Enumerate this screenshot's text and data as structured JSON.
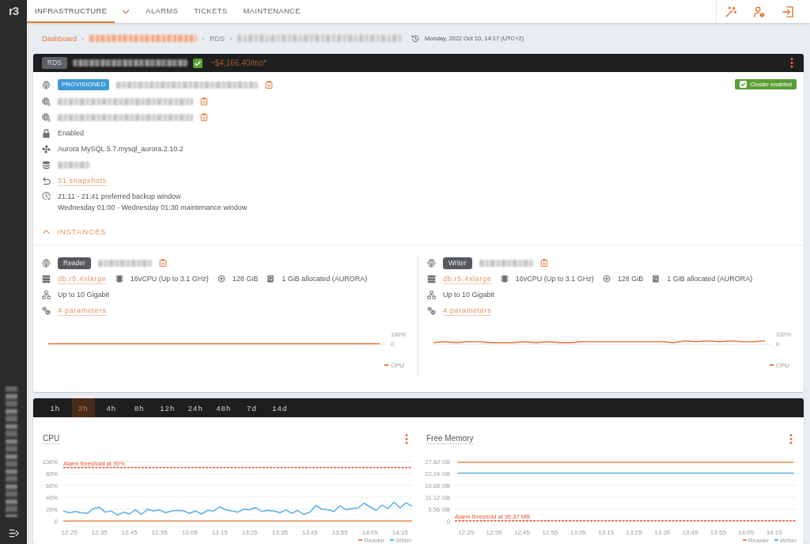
{
  "sidebar": {
    "logo": "r3",
    "redacted": true
  },
  "nav": {
    "tabs": [
      {
        "label": "INFRASTRUCTURE",
        "selected": true
      },
      {
        "label": "ALARMS",
        "selected": false
      },
      {
        "label": "TICKETS",
        "selected": false
      },
      {
        "label": "MAINTENANCE",
        "selected": false
      }
    ]
  },
  "breadcrumb": {
    "items": [
      {
        "kind": "link",
        "label": "Dashboard"
      },
      {
        "kind": "redacted-link"
      },
      {
        "kind": "text",
        "label": "RDS"
      },
      {
        "kind": "redacted"
      }
    ],
    "timestamp": "Monday, 2022 Oct 10, 14:17 (UTC+2)"
  },
  "cluster": {
    "type_badge": "RDS",
    "name_redacted": true,
    "header_checkbox": {
      "checked": true
    },
    "cost": "~$4,166.40/mo*",
    "cluster_enabled": {
      "label": "Cluster enabled",
      "checked": true
    },
    "details": [
      {
        "kind": "identifier",
        "badge": "PROVISIONED",
        "redacted": true,
        "copyable": true
      },
      {
        "kind": "endpoint",
        "redacted": true,
        "copyable": true
      },
      {
        "kind": "endpoint",
        "redacted": true,
        "copyable": true
      },
      {
        "kind": "encryption",
        "text": "Enabled"
      },
      {
        "kind": "engine",
        "text": "Aurora MySQL 5.7.mysql_aurora.2.10.2"
      },
      {
        "kind": "database",
        "redacted": true
      },
      {
        "kind": "snapshots",
        "link": "31 snapshots"
      },
      {
        "kind": "schedule",
        "lines": [
          "21:11 - 21:41 preferred backup window",
          "Wednesday 01:00 - Wednesday 01:30 maintenance window"
        ]
      }
    ],
    "instances_section": {
      "label": "INSTANCES",
      "expanded": true
    },
    "instances": [
      {
        "role": "Reader",
        "redacted": true,
        "copyable": true,
        "instance_class": "db.r5.4xlarge",
        "cpu": "16vCPU (Up to 3.1 GHz)",
        "memory": "128 GiB",
        "storage": "1 GiB allocated (AURORA)",
        "network": "Up to 10 Gigabit",
        "parameters": "4 parameters",
        "chart_data": {
          "type": "line",
          "ylim": [
            0,
            100
          ],
          "yticks": [
            0,
            {
              "value": 100,
              "label": "100%"
            }
          ],
          "legend": "bottom-right",
          "series": [
            {
              "name": "CPU",
              "color": "#e8793e",
              "values": [
                0,
                0,
                0,
                0,
                0,
                0,
                0,
                0,
                0,
                0,
                0,
                0,
                0,
                0,
                0,
                0,
                0,
                0,
                0,
                0,
                0,
                0,
                0,
                0,
                0,
                0,
                0,
                0,
                0,
                0
              ]
            }
          ]
        }
      },
      {
        "role": "Writer",
        "redacted": true,
        "copyable": true,
        "instance_class": "db.r5.4xlarge",
        "cpu": "16vCPU (Up to 3.1 GHz)",
        "memory": "128 GiB",
        "storage": "1 GiB allocated (AURORA)",
        "network": "Up to 10 Gigabit",
        "parameters": "4 parameters",
        "chart_data": {
          "type": "line",
          "ylim": [
            0,
            100
          ],
          "yticks": [
            0,
            {
              "value": 100,
              "label": "100%"
            }
          ],
          "legend": "bottom-right",
          "series": [
            {
              "name": "CPU",
              "color": "#e8793e",
              "values": [
                10,
                20,
                10,
                20,
                20,
                10,
                10,
                10,
                20,
                10,
                20,
                10,
                10,
                20,
                20,
                20,
                20,
                20,
                20,
                20,
                20,
                10,
                30,
                20,
                30,
                20,
                30,
                20,
                20,
                30
              ]
            }
          ]
        }
      }
    ]
  },
  "metrics": {
    "ranges": [
      {
        "label": "1h",
        "selected": false
      },
      {
        "label": "2h",
        "selected": true
      },
      {
        "label": "4h",
        "selected": false
      },
      {
        "label": "8h",
        "selected": false
      },
      {
        "label": "12h",
        "selected": false
      },
      {
        "label": "24h",
        "selected": false
      },
      {
        "label": "48h",
        "selected": false
      },
      {
        "label": "7d",
        "selected": false
      },
      {
        "label": "14d",
        "selected": false
      }
    ],
    "charts": [
      {
        "chart_data": {
          "type": "line",
          "title": "CPU",
          "grid": true,
          "legend": "bottom-right",
          "x": [
            743,
            745,
            747,
            749,
            751,
            753,
            755,
            757,
            759,
            761,
            763,
            765,
            767,
            769,
            771,
            773,
            775,
            777,
            779,
            781,
            783,
            785,
            787,
            789,
            791,
            793,
            795,
            797,
            799,
            801,
            803,
            805,
            807,
            809,
            811,
            813,
            815,
            817,
            819,
            821,
            823,
            825,
            827,
            829,
            831,
            833,
            835,
            837,
            839,
            841,
            843,
            845,
            847,
            849,
            851,
            853,
            855,
            857,
            859
          ],
          "xlim": [
            743,
            859
          ],
          "xticks": [
            {
              "value": 745,
              "label": "12:25"
            },
            {
              "value": 755,
              "label": "12:35"
            },
            {
              "value": 765,
              "label": "12:45"
            },
            {
              "value": 775,
              "label": "12:55"
            },
            {
              "value": 785,
              "label": "13:05"
            },
            {
              "value": 795,
              "label": "13:15"
            },
            {
              "value": 805,
              "label": "13:25"
            },
            {
              "value": 815,
              "label": "13:35"
            },
            {
              "value": 825,
              "label": "13:45"
            },
            {
              "value": 835,
              "label": "13:55"
            },
            {
              "value": 845,
              "label": "14:05"
            },
            {
              "value": 855,
              "label": "14:15"
            }
          ],
          "ylim": [
            0,
            100
          ],
          "yticks": [
            0,
            {
              "value": 20,
              "label": "20%"
            },
            {
              "value": 40,
              "label": "40%"
            },
            {
              "value": 60,
              "label": "60%"
            },
            {
              "value": 80,
              "label": "80%"
            },
            {
              "value": 100,
              "label": "100%"
            }
          ],
          "series": [
            {
              "name": "Reader",
              "color": "#ee8a50",
              "values": [
                0,
                0,
                0,
                0,
                0,
                0,
                0,
                0,
                0,
                0,
                0,
                0,
                0,
                0,
                0,
                0,
                0,
                0,
                0,
                0,
                0,
                0,
                0,
                0,
                0,
                0,
                0,
                0,
                0,
                0,
                0,
                0,
                0,
                0,
                0,
                0,
                0,
                0,
                0,
                0,
                0,
                0,
                0,
                0,
                0,
                0,
                0,
                0,
                0,
                0,
                0,
                0,
                0,
                0,
                0,
                0,
                0,
                0,
                0
              ]
            },
            {
              "name": "Writer",
              "color": "#5bb0e3",
              "values": [
                17,
                14,
                16,
                14,
                13,
                21,
                23,
                15,
                17,
                10,
                15,
                12,
                19,
                11,
                20,
                17,
                19,
                14,
                17,
                18,
                17,
                13,
                17,
                12,
                18,
                17,
                24,
                19,
                17,
                15,
                20,
                19,
                23,
                16,
                18,
                17,
                14,
                19,
                13,
                18,
                11,
                15,
                26,
                20,
                19,
                16,
                26,
                19,
                21,
                22,
                30,
                24,
                18,
                27,
                21,
                32,
                22,
                31,
                25
              ]
            }
          ],
          "ref_lines": [
            {
              "axis": "y",
              "value": 90,
              "label": "Alarm threshold at 90%",
              "color": "#e8542f"
            }
          ]
        }
      },
      {
        "chart_data": {
          "type": "line",
          "title": "Free Memory",
          "grid": true,
          "legend": "bottom-right",
          "x": [
            742,
            752,
            762,
            772,
            782,
            792,
            802,
            812,
            822,
            832,
            842,
            852,
            862
          ],
          "xlim": [
            741,
            863
          ],
          "xticks": [
            {
              "value": 745,
              "label": "12:25"
            },
            {
              "value": 755,
              "label": "12:35"
            },
            {
              "value": 765,
              "label": "12:45"
            },
            {
              "value": 775,
              "label": "12:55"
            },
            {
              "value": 785,
              "label": "13:05"
            },
            {
              "value": 795,
              "label": "13:15"
            },
            {
              "value": 805,
              "label": "13:25"
            },
            {
              "value": 815,
              "label": "13:35"
            },
            {
              "value": 825,
              "label": "13:45"
            },
            {
              "value": 835,
              "label": "13:55"
            },
            {
              "value": 845,
              "label": "14:05"
            },
            {
              "value": 855,
              "label": "14:15"
            }
          ],
          "ylim": [
            0,
            27.8
          ],
          "yticks": [
            0,
            {
              "value": 5.56,
              "label": "5.56 GB"
            },
            {
              "value": 11.12,
              "label": "11.12 GB"
            },
            {
              "value": 16.68,
              "label": "16.68 GB"
            },
            {
              "value": 22.24,
              "label": "22.24 GB"
            },
            {
              "value": 27.8,
              "label": "27.80 GB"
            }
          ],
          "series": [
            {
              "name": "Reader",
              "color": "#ee8a50",
              "values": [
                27.5,
                27.5,
                27.5,
                27.5,
                27.5,
                27.5,
                27.5,
                27.5,
                27.5,
                27.5,
                27.5,
                27.5,
                27.5
              ]
            },
            {
              "name": "Writer",
              "color": "#5bb0e3",
              "values": [
                22.4,
                22.4,
                22.4,
                22.4,
                22.4,
                22.4,
                22.4,
                22.4,
                22.4,
                22.4,
                22.4,
                22.4,
                22.4
              ]
            }
          ],
          "ref_lines": [
            {
              "axis": "y",
              "value": 0.0931,
              "label": "Alarm threshold at 95.37 MB",
              "color": "#e8542f"
            }
          ]
        }
      }
    ]
  }
}
